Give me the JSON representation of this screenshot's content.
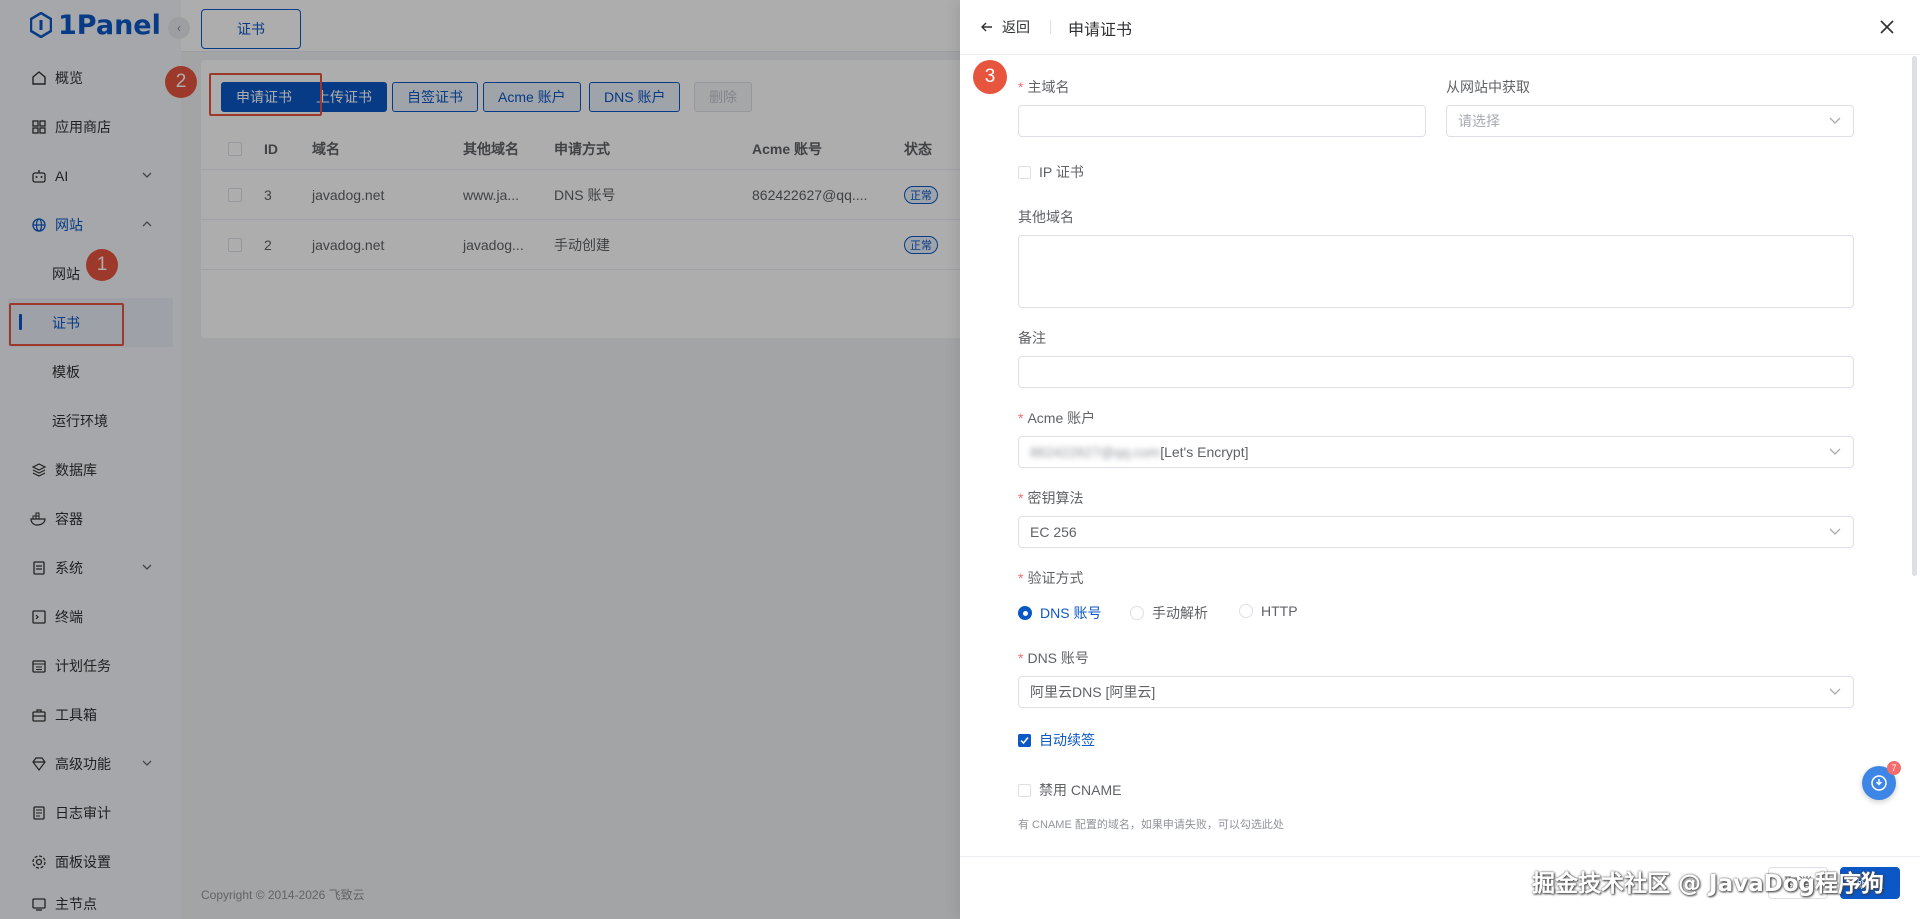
{
  "app": {
    "logo_text": "1Panel"
  },
  "sidebar": {
    "items": [
      {
        "label": "概览",
        "icon": "home-icon"
      },
      {
        "label": "应用商店",
        "icon": "grid-icon"
      },
      {
        "label": "AI",
        "icon": "robot-icon"
      },
      {
        "label": "网站",
        "icon": "globe-icon"
      },
      {
        "label": "网站"
      },
      {
        "label": "证书"
      },
      {
        "label": "模板"
      },
      {
        "label": "运行环境"
      },
      {
        "label": "数据库",
        "icon": "layers-icon"
      },
      {
        "label": "容器",
        "icon": "docker-icon"
      },
      {
        "label": "系统",
        "icon": "server-icon"
      },
      {
        "label": "终端",
        "icon": "terminal-icon"
      },
      {
        "label": "计划任务",
        "icon": "calendar-icon"
      },
      {
        "label": "工具箱",
        "icon": "toolbox-icon"
      },
      {
        "label": "高级功能",
        "icon": "diamond-icon"
      },
      {
        "label": "日志审计",
        "icon": "log-icon"
      },
      {
        "label": "面板设置",
        "icon": "gear-icon"
      },
      {
        "label": "主节点",
        "icon": "node-icon"
      }
    ]
  },
  "tabs": {
    "active": "证书"
  },
  "toolbar": {
    "apply_cert": "申请证书",
    "upload_cert": "上传证书",
    "self_signed": "自签证书",
    "acme_account": "Acme 账户",
    "dns_account": "DNS 账户",
    "delete": "删除"
  },
  "table": {
    "headers": [
      "ID",
      "域名",
      "其他域名",
      "申请方式",
      "Acme 账号",
      "状态"
    ],
    "rows": [
      {
        "id": "3",
        "domain": "javadog.net",
        "other": "www.ja...",
        "method": "DNS 账号",
        "acme": "862422627@qq....",
        "status": "正常"
      },
      {
        "id": "2",
        "domain": "javadog.net",
        "other": "javadog...",
        "method": "手动创建",
        "acme": "",
        "status": "正常"
      }
    ]
  },
  "footer": {
    "copyright": "Copyright © 2014-2026 飞致云"
  },
  "annotations": {
    "b1": "1",
    "b2": "2",
    "b3": "3"
  },
  "drawer": {
    "back": "返回",
    "title": "申请证书",
    "primary_domain_label": "主域名",
    "primary_domain_value": "",
    "from_site_label": "从网站中获取",
    "from_site_placeholder": "请选择",
    "ip_cert_label": "IP 证书",
    "other_domains_label": "其他域名",
    "remark_label": "备注",
    "acme_label": "Acme 账户",
    "acme_value_blurred": "862422627@qq.com",
    "acme_value_suffix": "[Let's Encrypt]",
    "key_algo_label": "密钥算法",
    "key_algo_value": "EC 256",
    "verify_label": "验证方式",
    "verify_options": [
      "DNS 账号",
      "手动解析",
      "HTTP"
    ],
    "verify_selected": "DNS 账号",
    "dns_account_label": "DNS 账号",
    "dns_account_value": "阿里云DNS [阿里云]",
    "auto_renew_label": "自动续签",
    "auto_renew_checked": true,
    "disable_cname_label": "禁用 CNAME",
    "cname_hint": "有 CNAME 配置的域名，如果申请失败，可以勾选此处",
    "fab_count": "7",
    "cancel": "取消",
    "confirm": "确认"
  },
  "watermark": "掘金技术社区 @ JavaDog程序狗",
  "colors": {
    "brand": "#0b57c5",
    "annotation": "#e8553e",
    "required": "#f56c6c"
  }
}
